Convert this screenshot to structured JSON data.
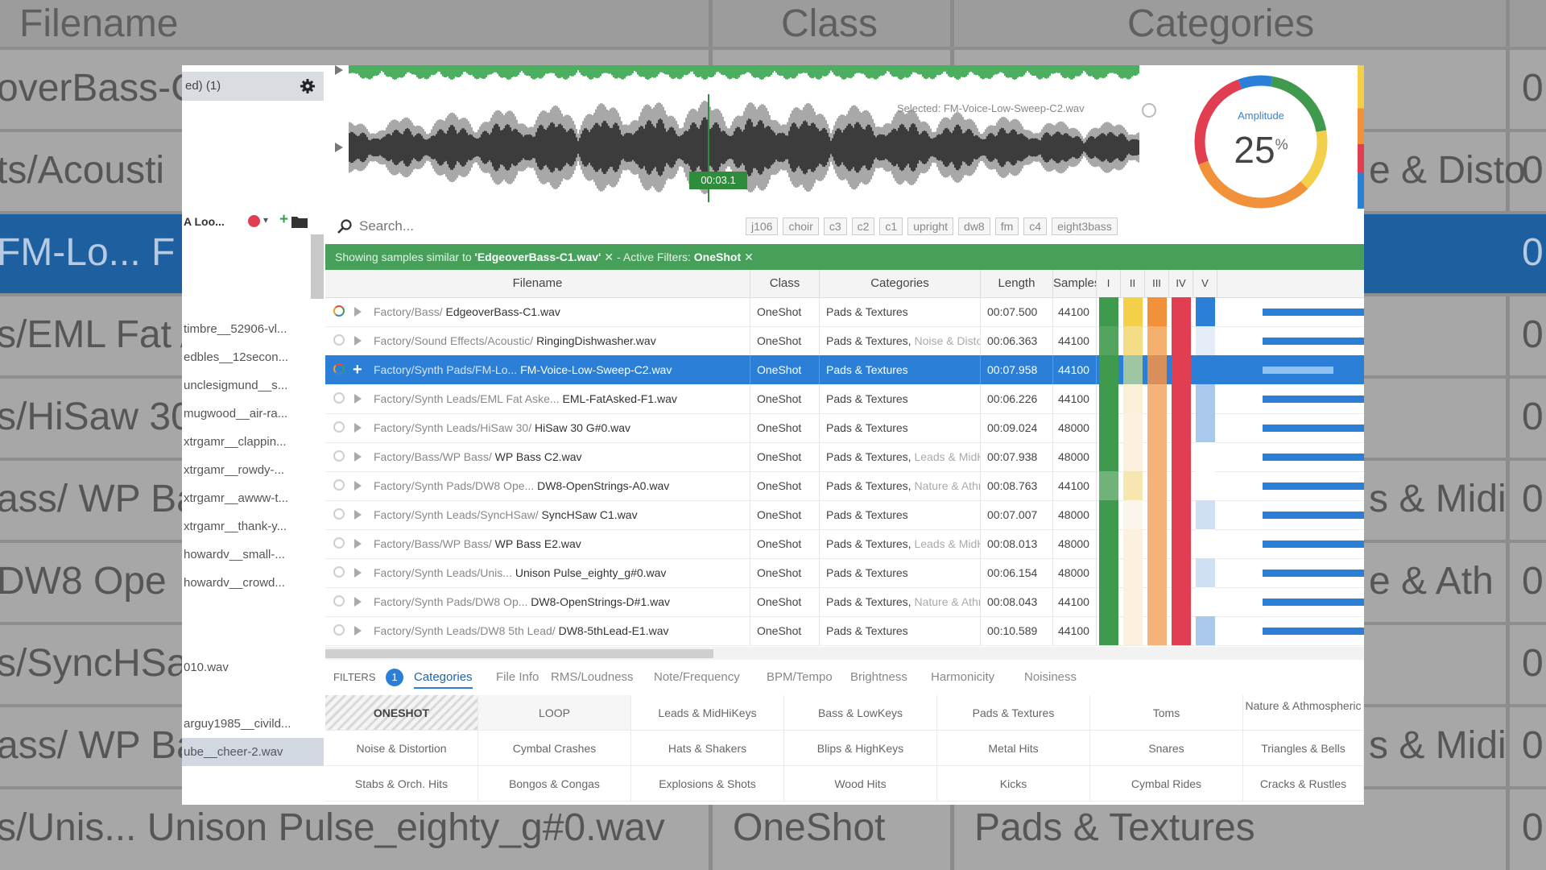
{
  "background": {
    "headers": [
      "Filename",
      "Class",
      "Categories"
    ],
    "rows": [
      {
        "left": "overBass-C",
        "right": "0"
      },
      {
        "left": "ts/Acousti",
        "right": "0",
        "mid": "e & Disto"
      },
      {
        "left": "FM-Lo... F",
        "right": "0",
        "selected": true
      },
      {
        "left": "s/EML Fat A",
        "right": "0"
      },
      {
        "left": "s/HiSaw 30",
        "right": "0"
      },
      {
        "left": "ass/ WP Ba",
        "right": "0",
        "mid": "s & Midi"
      },
      {
        "left": "DW8 Ope",
        "right": "0",
        "mid": "e & Ath"
      },
      {
        "left": "s/SyncHSa",
        "right": "0"
      },
      {
        "left": "ass/ WP Ba",
        "right": "0",
        "mid": "s & Midi"
      },
      {
        "left": "s/Unis... Unison Pulse_eighty_g#0.wav",
        "class": "OneShot",
        "cat": "Pads & Textures",
        "right": "0"
      }
    ]
  },
  "left_panel": {
    "top_label": "ed) (1)",
    "tool_label": "A Loo...",
    "items": [
      "timbre__52906-vl...",
      "edbles__12secon...",
      "unclesigmund__s...",
      "mugwood__air-ra...",
      "xtrgamr__clappin...",
      "xtrgamr__rowdy-...",
      "xtrgamr__awww-t...",
      "xtrgamr__thank-y...",
      "howardv__small-...",
      "howardv__crowd...",
      "",
      "",
      "010.wav",
      "",
      "arguy1985__civild...",
      "ube__cheer-2.wav"
    ]
  },
  "waveform": {
    "selected_label": "Selected: FM-Voice-Low-Sweep-C2.wav",
    "time": "00:03.1"
  },
  "gauge": {
    "label": "Amplitude",
    "value": "25",
    "unit": "%",
    "percent": 25
  },
  "search": {
    "placeholder": "Search...",
    "tags": [
      "j106",
      "choir",
      "c3",
      "c2",
      "c1",
      "upright",
      "dw8",
      "fm",
      "c4",
      "eight3bass"
    ]
  },
  "banner": {
    "prefix": "Showing samples similar to ",
    "file": "'EdgeoverBass-C1.wav'",
    "middle": "- Active Filters:",
    "filter": "OneShot"
  },
  "table": {
    "headers": [
      "Filename",
      "Class",
      "Categories",
      "Length",
      "Samples",
      "I",
      "II",
      "III",
      "IV",
      "V"
    ],
    "rows": [
      {
        "path": "Factory/Bass/",
        "file": "EdgeoverBass-C1.wav",
        "class": "OneShot",
        "cat": "Pads & Textures",
        "extra": "",
        "length": "00:07.500",
        "sr": "44100",
        "colors": [
          "#3f9a4e",
          "#f3cf4a",
          "#f1923b",
          "#e23e52",
          "#2b7fd6"
        ],
        "bar": 1.0,
        "active": true
      },
      {
        "path": "Factory/Sound Effects/Acoustic/",
        "file": "RingingDishwasher.wav",
        "class": "OneShot",
        "cat": "Pads & Textures,",
        "extra": " Noise & Distortion",
        "length": "00:06.363",
        "sr": "44100",
        "colors": [
          "#53a45f",
          "#f5dc86",
          "#f5b06e",
          "#e23e52",
          "#e3ecf7"
        ],
        "bar": 1.0
      },
      {
        "path": "Factory/Synth Pads/FM-Lo...",
        "file": "FM-Voice-Low-Sweep-C2.wav",
        "class": "OneShot",
        "cat": "Pads & Textures",
        "extra": "",
        "length": "00:07.958",
        "sr": "44100",
        "colors": [
          "#3f9a4e",
          "#9ec6a4",
          "#d98f5a",
          "#e23e52",
          "#2b7fd6"
        ],
        "bar": 0.7,
        "selected": true
      },
      {
        "path": "Factory/Synth Leads/EML Fat Aske...",
        "file": "EML-FatAsked-F1.wav",
        "class": "OneShot",
        "cat": "Pads & Textures",
        "extra": "",
        "length": "00:06.226",
        "sr": "44100",
        "colors": [
          "#3f9a4e",
          "#fbefd6",
          "#f5b27a",
          "#e23e52",
          "#a9c8ec"
        ],
        "bar": 1.0
      },
      {
        "path": "Factory/Synth Leads/HiSaw 30/",
        "file": "HiSaw 30 G#0.wav",
        "class": "OneShot",
        "cat": "Pads & Textures",
        "extra": "",
        "length": "00:09.024",
        "sr": "48000",
        "colors": [
          "#3f9a4e",
          "#fbf1de",
          "#f5b27a",
          "#e23e52",
          "#a9c8ec"
        ],
        "bar": 1.0
      },
      {
        "path": "Factory/Bass/WP Bass/",
        "file": "WP Bass C2.wav",
        "class": "OneShot",
        "cat": "Pads & Textures,",
        "extra": " Leads & MidHiKeys",
        "length": "00:07.938",
        "sr": "48000",
        "colors": [
          "#3f9a4e",
          "#fbf1de",
          "#f5b27a",
          "#e23e52",
          "#ffffff"
        ],
        "bar": 1.0
      },
      {
        "path": "Factory/Synth Pads/DW8 Ope...",
        "file": "DW8-OpenStrings-A0.wav",
        "class": "OneShot",
        "cat": "Pads & Textures,",
        "extra": " Nature & Athmospheric",
        "length": "00:08.763",
        "sr": "44100",
        "colors": [
          "#6fb27a",
          "#f7e6b0",
          "#f5b27a",
          "#e23e52",
          "#ffffff"
        ],
        "bar": 1.0
      },
      {
        "path": "Factory/Synth Leads/SyncHSaw/",
        "file": "SyncHSaw C1.wav",
        "class": "OneShot",
        "cat": "Pads & Textures",
        "extra": "",
        "length": "00:07.007",
        "sr": "48000",
        "colors": [
          "#3f9a4e",
          "#fbf6ec",
          "#f5b27a",
          "#e23e52",
          "#cfe0f4"
        ],
        "bar": 1.0
      },
      {
        "path": "Factory/Bass/WP Bass/",
        "file": "WP Bass E2.wav",
        "class": "OneShot",
        "cat": "Pads & Textures,",
        "extra": " Leads & MidHiKeys",
        "length": "00:08.013",
        "sr": "48000",
        "colors": [
          "#3f9a4e",
          "#fbf1de",
          "#f5b27a",
          "#e23e52",
          "#ffffff"
        ],
        "bar": 1.0
      },
      {
        "path": "Factory/Synth Leads/Unis...",
        "file": "Unison Pulse_eighty_g#0.wav",
        "class": "OneShot",
        "cat": "Pads & Textures",
        "extra": "",
        "length": "00:06.154",
        "sr": "48000",
        "colors": [
          "#3f9a4e",
          "#fbf1de",
          "#f5b27a",
          "#e23e52",
          "#cfe0f4"
        ],
        "bar": 1.0
      },
      {
        "path": "Factory/Synth Pads/DW8 Op...",
        "file": "DW8-OpenStrings-D#1.wav",
        "class": "OneShot",
        "cat": "Pads & Textures,",
        "extra": " Nature & Athmospheric",
        "length": "00:08.043",
        "sr": "44100",
        "colors": [
          "#3f9a4e",
          "#fbf1de",
          "#f5b27a",
          "#e23e52",
          "#ffffff"
        ],
        "bar": 1.0
      },
      {
        "path": "Factory/Synth Leads/DW8 5th Lead/",
        "file": "DW8-5thLead-E1.wav",
        "class": "OneShot",
        "cat": "Pads & Textures",
        "extra": "",
        "length": "00:10.589",
        "sr": "44100",
        "colors": [
          "#3f9a4e",
          "#fbf1de",
          "#f5b27a",
          "#e23e52",
          "#a9c8ec"
        ],
        "bar": 1.0
      }
    ]
  },
  "filter_tabs": {
    "filters_label": "FILTERS",
    "count": "1",
    "tabs": [
      "Categories",
      "File Info",
      "RMS/Loudness",
      "Note/Frequency",
      "BPM/Tempo",
      "Brightness",
      "Harmonicity",
      "Noisiness"
    ],
    "active": "Categories"
  },
  "categories": [
    [
      "ONESHOT",
      "LOOP",
      "Leads & MidHiKeys",
      "Bass & LowKeys",
      "Pads & Textures",
      "Toms",
      "Nature & Athmospheric"
    ],
    [
      "Noise & Distortion",
      "Cymbal Crashes",
      "Hats & Shakers",
      "Blips & HighKeys",
      "Metal Hits",
      "Snares",
      "Triangles & Bells"
    ],
    [
      "Stabs & Orch. Hits",
      "Bongos & Congas",
      "Explosions & Shots",
      "Wood Hits",
      "Kicks",
      "Cymbal Rides",
      "Cracks & Rustles"
    ]
  ],
  "colors": {
    "accent_blue": "#2b7fd6",
    "banner_green": "#46a05a",
    "wave_dark": "#3c3c3c",
    "wave_green": "#4caf5f"
  }
}
